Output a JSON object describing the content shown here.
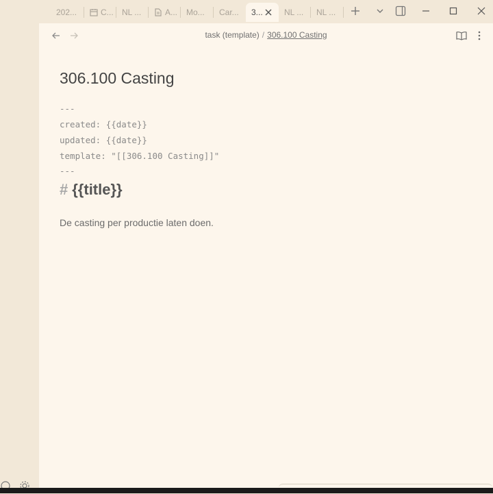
{
  "tabs": [
    {
      "label": "202...",
      "icon": "none"
    },
    {
      "label": "C...",
      "icon": "calendar-icon"
    },
    {
      "label": "NL ...",
      "icon": "none"
    },
    {
      "label": "A...",
      "icon": "file-icon"
    },
    {
      "label": "Mo...",
      "icon": "none"
    },
    {
      "label": "Car...",
      "icon": "none"
    },
    {
      "label": "3...",
      "icon": "none",
      "active": true
    },
    {
      "label": "NL ...",
      "icon": "none"
    },
    {
      "label": "NL ...",
      "icon": "none"
    }
  ],
  "breadcrumb": {
    "parent": "task (template)",
    "separator": "/",
    "current": "306.100 Casting"
  },
  "note": {
    "title": "306.100 Casting",
    "frontmatter_open": "---",
    "created_line": "created: {{date}}",
    "updated_line": "updated: {{date}}",
    "template_line": "template: \"[[306.100 Casting]]\"",
    "frontmatter_close": "---",
    "heading_hash": "#",
    "heading_text": "{{title}}",
    "body": "De casting per productie laten doen."
  },
  "colors": {
    "chrome": "#f2e8d8",
    "editor": "#fdf6ec",
    "muted_text": "#8a8a8a"
  }
}
